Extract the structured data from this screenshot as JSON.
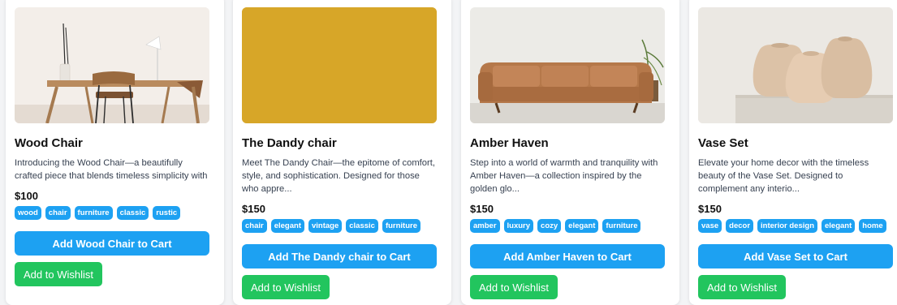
{
  "products": [
    {
      "title": "Wood Chair",
      "description": "Introducing the Wood Chair—a beautifully crafted piece that blends timeless simplicity with natural ...",
      "price": "$100",
      "tags": [
        "wood",
        "chair",
        "furniture",
        "classic",
        "rustic"
      ],
      "cart_label": "Add Wood Chair to Cart",
      "wishlist_label": "Add to Wishlist"
    },
    {
      "title": "The Dandy chair",
      "description": "Meet The Dandy Chair—the epitome of comfort, style, and sophistication. Designed for those who appre...",
      "price": "$150",
      "tags": [
        "chair",
        "elegant",
        "vintage",
        "classic",
        "furniture"
      ],
      "cart_label": "Add The Dandy chair to Cart",
      "wishlist_label": "Add to Wishlist"
    },
    {
      "title": "Amber Haven",
      "description": "Step into a world of warmth and tranquility with Amber Haven—a collection inspired by the golden glo...",
      "price": "$150",
      "tags": [
        "amber",
        "luxury",
        "cozy",
        "elegant",
        "furniture"
      ],
      "cart_label": "Add Amber Haven to Cart",
      "wishlist_label": "Add to Wishlist"
    },
    {
      "title": "Vase Set",
      "description": "Elevate your home decor with the timeless beauty of the Vase Set. Designed to complement any interio...",
      "price": "$150",
      "tags": [
        "vase",
        "decor",
        "interior design",
        "elegant",
        "home"
      ],
      "cart_label": "Add Vase Set to Cart",
      "wishlist_label": "Add to Wishlist"
    }
  ],
  "colors": {
    "cart_button": "#1da1f2",
    "tag": "#1da1f2",
    "wishlist_button": "#22c55e",
    "dandy_image": "#d4a326"
  }
}
